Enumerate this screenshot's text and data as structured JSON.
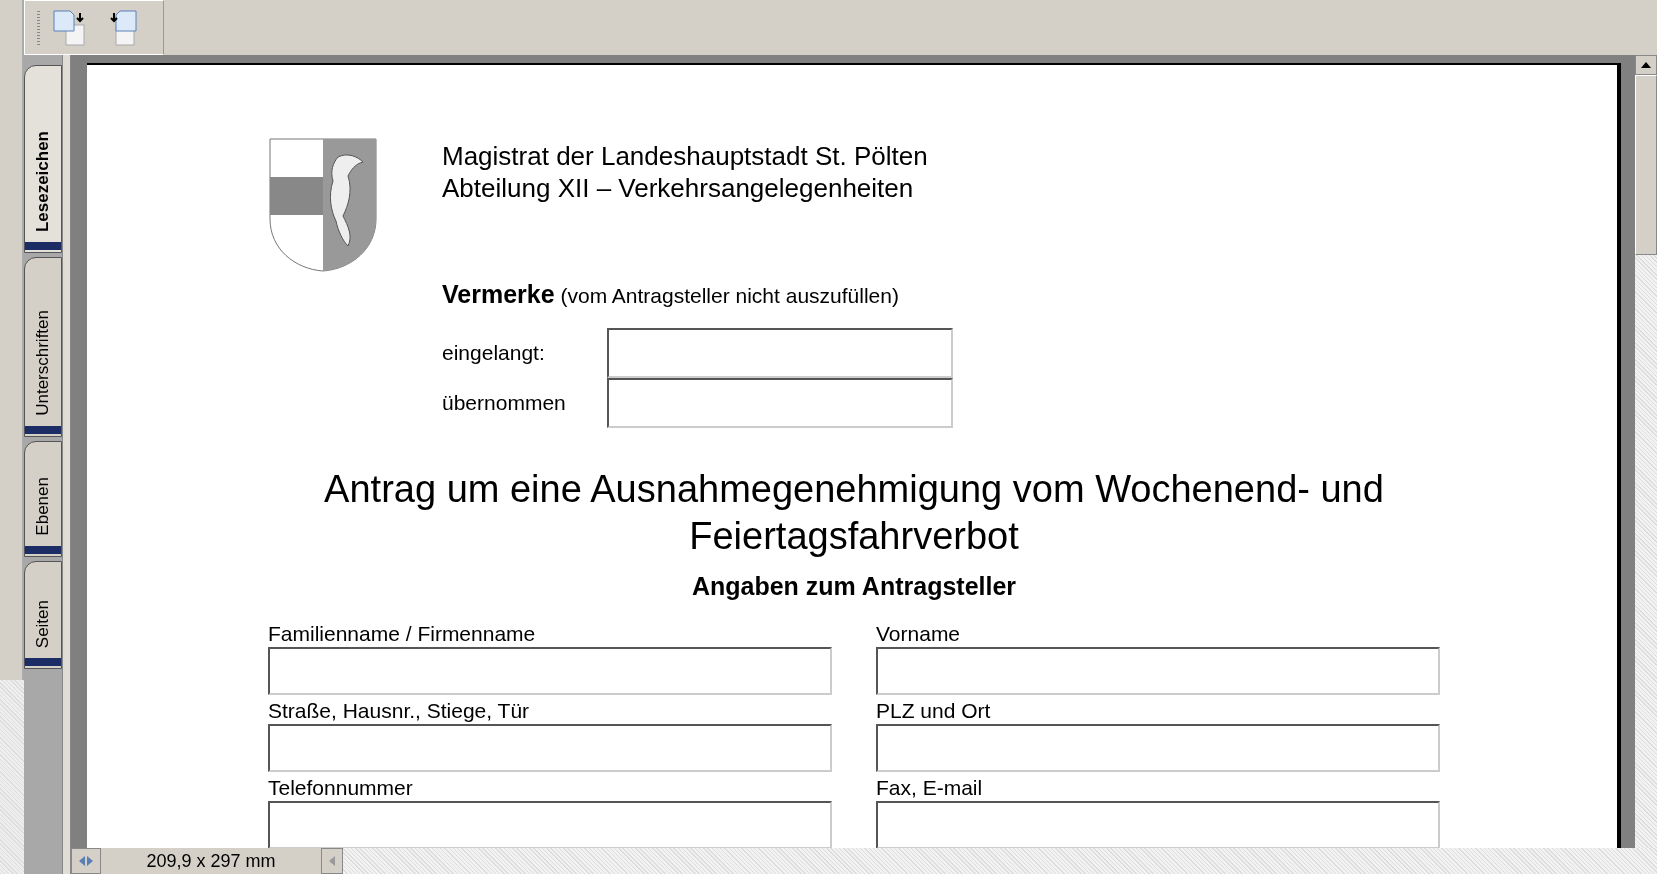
{
  "side_tabs": [
    {
      "label": "Lesezeichen",
      "selected": true
    },
    {
      "label": "Unterschriften",
      "selected": false
    },
    {
      "label": "Ebenen",
      "selected": false
    },
    {
      "label": "Seiten",
      "selected": false
    }
  ],
  "document": {
    "header_lines": [
      "Magistrat der Landeshauptstadt St. Pölten",
      "Abteilung XII – Verkehrsangelegenheiten"
    ],
    "vermerke": {
      "title": "Vermerke",
      "note": "(vom Antragsteller nicht auszufüllen)",
      "fields": [
        {
          "label": "eingelangt:"
        },
        {
          "label": "übernommen"
        }
      ]
    },
    "title_lines": [
      "Antrag um eine Ausnahmegenehmigung vom Wochenend- und",
      "Feiertagsfahrverbot"
    ],
    "section_heading": "Angaben zum Antragsteller",
    "form_fields": [
      {
        "label": "Familienname / Firmenname"
      },
      {
        "label": "Vorname"
      },
      {
        "label": "Straße, Hausnr., Stiege, Tür"
      },
      {
        "label": "PLZ und Ort"
      },
      {
        "label": "Telefonnummer"
      },
      {
        "label": "Fax, E-mail"
      }
    ]
  },
  "status_bar": {
    "page_size": "209,9 x 297 mm"
  }
}
